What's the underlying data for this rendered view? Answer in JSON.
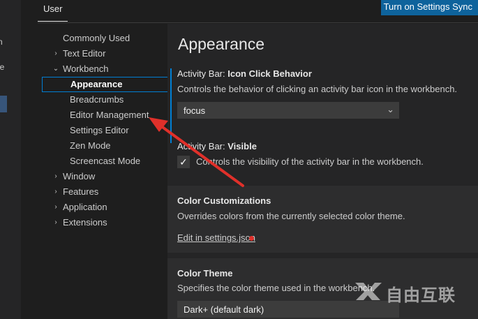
{
  "activity_bar": {
    "fragments": [
      "n",
      "le"
    ]
  },
  "header": {
    "user_tab": "User",
    "sync_button": "Turn on Settings Sync"
  },
  "toc": {
    "items": [
      {
        "label": "Commonly Used",
        "level": 0,
        "chevron": ""
      },
      {
        "label": "Text Editor",
        "level": 0,
        "chevron": "›"
      },
      {
        "label": "Workbench",
        "level": 0,
        "chevron": "⌄"
      },
      {
        "label": "Appearance",
        "level": 1,
        "chevron": ""
      },
      {
        "label": "Breadcrumbs",
        "level": 1,
        "chevron": ""
      },
      {
        "label": "Editor Management",
        "level": 1,
        "chevron": ""
      },
      {
        "label": "Settings Editor",
        "level": 1,
        "chevron": ""
      },
      {
        "label": "Zen Mode",
        "level": 1,
        "chevron": ""
      },
      {
        "label": "Screencast Mode",
        "level": 1,
        "chevron": ""
      },
      {
        "label": "Window",
        "level": 0,
        "chevron": "›"
      },
      {
        "label": "Features",
        "level": 0,
        "chevron": "›"
      },
      {
        "label": "Application",
        "level": 0,
        "chevron": "›"
      },
      {
        "label": "Extensions",
        "level": 0,
        "chevron": "›"
      }
    ]
  },
  "main": {
    "page_title": "Appearance",
    "icon_click": {
      "category": "Activity Bar: ",
      "name": "Icon Click Behavior",
      "description": "Controls the behavior of clicking an activity bar icon in the workbench.",
      "value": "focus"
    },
    "visible": {
      "category": "Activity Bar: ",
      "name": "Visible",
      "checkbox_label": "Controls the visibility of the activity bar in the workbench.",
      "checked": true
    },
    "color_customizations": {
      "title": "Color Customizations",
      "description": "Overrides colors from the currently selected color theme.",
      "link": "Edit in settings.json"
    },
    "color_theme": {
      "title": "Color Theme",
      "description": "Specifies the color theme used in the workbench.",
      "value": "Dark+ (default dark)"
    }
  },
  "watermark": {
    "text": "自由互联"
  },
  "colors": {
    "accent": "#007fd4",
    "button": "#0e639c",
    "annotation": "#e0302a"
  }
}
